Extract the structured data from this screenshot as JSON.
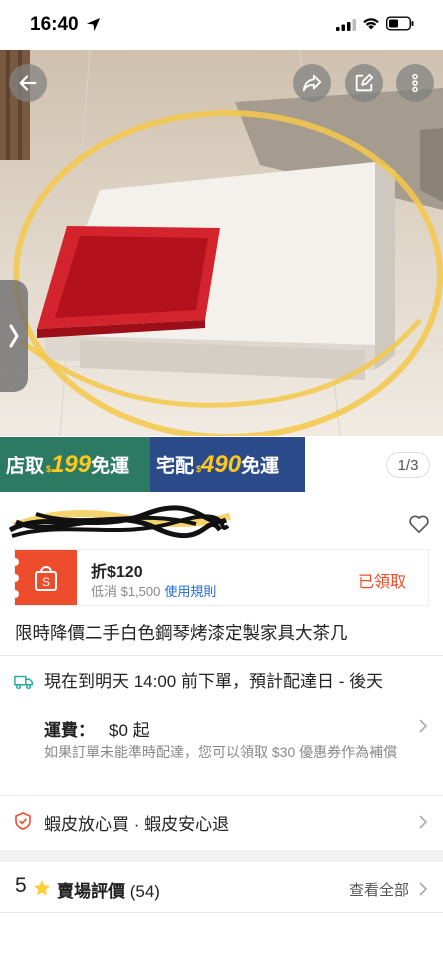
{
  "status_bar": {
    "time": "16:40"
  },
  "gallery": {
    "page_indicator": "1/3"
  },
  "promo": {
    "pickup_label": "店取",
    "pickup_currency": "$",
    "pickup_amount": "199",
    "pickup_free": "免運",
    "delivery_label": "宅配",
    "delivery_currency": "$",
    "delivery_amount": "490",
    "delivery_free": "免運"
  },
  "voucher": {
    "title": "折$120",
    "min_spend": "低消 $1,500",
    "rules_link": "使用規則",
    "status": "已領取"
  },
  "product": {
    "title": "限時降價二手白色鋼琴烤漆定製家具大茶几"
  },
  "shipping": {
    "line1": "現在到明天 14:00 前下單，預計配達日 - 後天",
    "fee_label": "運費：",
    "fee_value": "$0 起",
    "note": "如果訂單未能準時配達，您可以領取 $30 優惠券作為補償"
  },
  "guarantee": {
    "text": "蝦皮放心買 · 蝦皮安心退"
  },
  "rating": {
    "score": "5",
    "label": "賣場評價",
    "count": "(54)",
    "view_all": "查看全部"
  },
  "colors": {
    "accent": "#ee4d2d",
    "promo_green": "#2d7a62",
    "promo_blue": "#2b4a8a",
    "promo_yellow": "#ffc81e",
    "link_blue": "#1e6bd6",
    "star": "#ffce3d"
  },
  "icons": [
    "location-arrow-icon",
    "signal-icon",
    "wifi-icon",
    "battery-icon",
    "back-arrow-icon",
    "share-icon",
    "edit-icon",
    "more-vertical-icon",
    "chevron-right-icon",
    "heart-icon",
    "shopee-bag-icon",
    "truck-icon",
    "shield-icon",
    "star-icon"
  ]
}
